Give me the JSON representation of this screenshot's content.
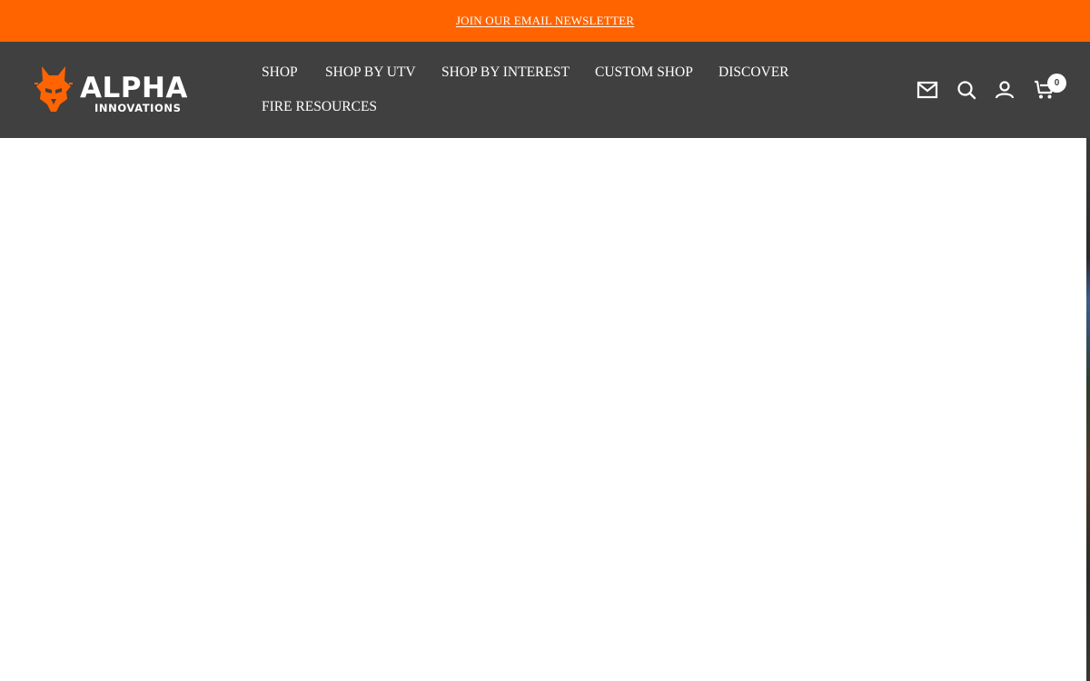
{
  "announcement": {
    "text": "JOIN OUR EMAIL NEWSLETTER"
  },
  "brand": {
    "name": "ALPHA",
    "tagline": "INNOVATIONS",
    "accent_color": "#ff6400",
    "header_color": "#404040"
  },
  "nav": {
    "items": [
      {
        "label": "SHOP"
      },
      {
        "label": "SHOP BY UTV"
      },
      {
        "label": "SHOP BY INTEREST"
      },
      {
        "label": "CUSTOM SHOP"
      },
      {
        "label": "DISCOVER"
      },
      {
        "label": "FIRE RESOURCES"
      }
    ]
  },
  "header_icons": {
    "newsletter": "mail-icon",
    "search": "search-icon",
    "account": "account-icon",
    "cart": "cart-icon",
    "cart_count": "0"
  }
}
